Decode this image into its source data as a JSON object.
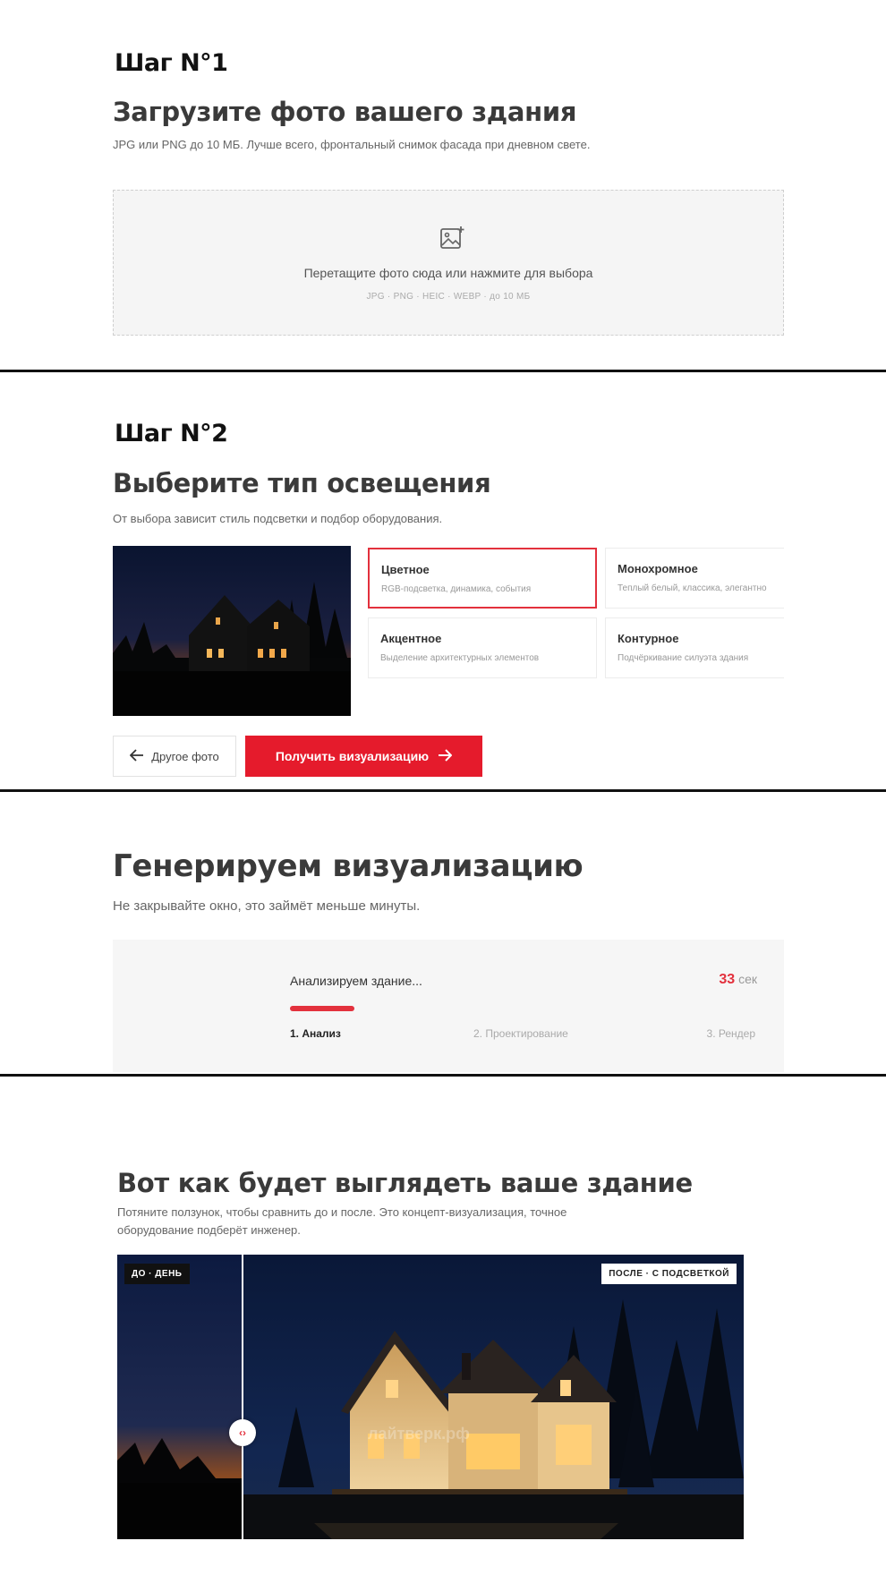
{
  "step1": {
    "label": "Шаг N°1",
    "title": "Загрузите фото вашего здания",
    "description": "JPG или PNG до 10 МБ. Лучше всего, фронтальный снимок фасада при дневном свете.",
    "dropzone": {
      "text": "Перетащите фото сюда или нажмите для выбора",
      "formats": "JPG · PNG · HEIC · WEBP  ·  до 10 МБ",
      "icon": "image-add-icon"
    }
  },
  "step2": {
    "label": "Шаг N°2",
    "title": "Выберите тип освещения",
    "description": "От выбора зависит стиль подсветки и подбор оборудования.",
    "options": [
      {
        "title": "Цветное",
        "subtitle": "RGB-подсветка, динамика, события",
        "selected": true
      },
      {
        "title": "Монохромное",
        "subtitle": "Теплый белый, классика, элегантно",
        "selected": false
      },
      {
        "title": "Акцентное",
        "subtitle": "Выделение архитектурных элементов",
        "selected": false
      },
      {
        "title": "Контурное",
        "subtitle": "Подчёркивание силуэта здания",
        "selected": false
      }
    ],
    "back_button": "Другое фото",
    "submit_button": "Получить визуализацию"
  },
  "step3": {
    "title": "Генерируем визуализацию",
    "description": "Не закрывайте окно, это займёт меньше минуты.",
    "status": "Анализируем здание...",
    "timer_value": "33",
    "timer_unit": "сек",
    "progress": 0.14,
    "stages": [
      "1. Анализ",
      "2. Проектирование",
      "3. Рендер"
    ],
    "active_stage": 0
  },
  "step4": {
    "title": "Вот как будет выглядеть ваше здание",
    "description_line1": "Потяните ползунок, чтобы сравнить до и после. Это концепт-визуализация, точное",
    "description_line2": "оборудование подберёт инженер.",
    "badge_before": "ДО · ДЕНЬ",
    "badge_after": "ПОСЛЕ · С ПОДСВЕТКОЙ",
    "watermark": "лайтверк.рф",
    "slider_position": 0.2,
    "handle_glyph": "‹›"
  },
  "colors": {
    "accent": "#e3313d",
    "button": "#e51b2c",
    "heading": "#3a3a3a",
    "divider": "#111111"
  }
}
